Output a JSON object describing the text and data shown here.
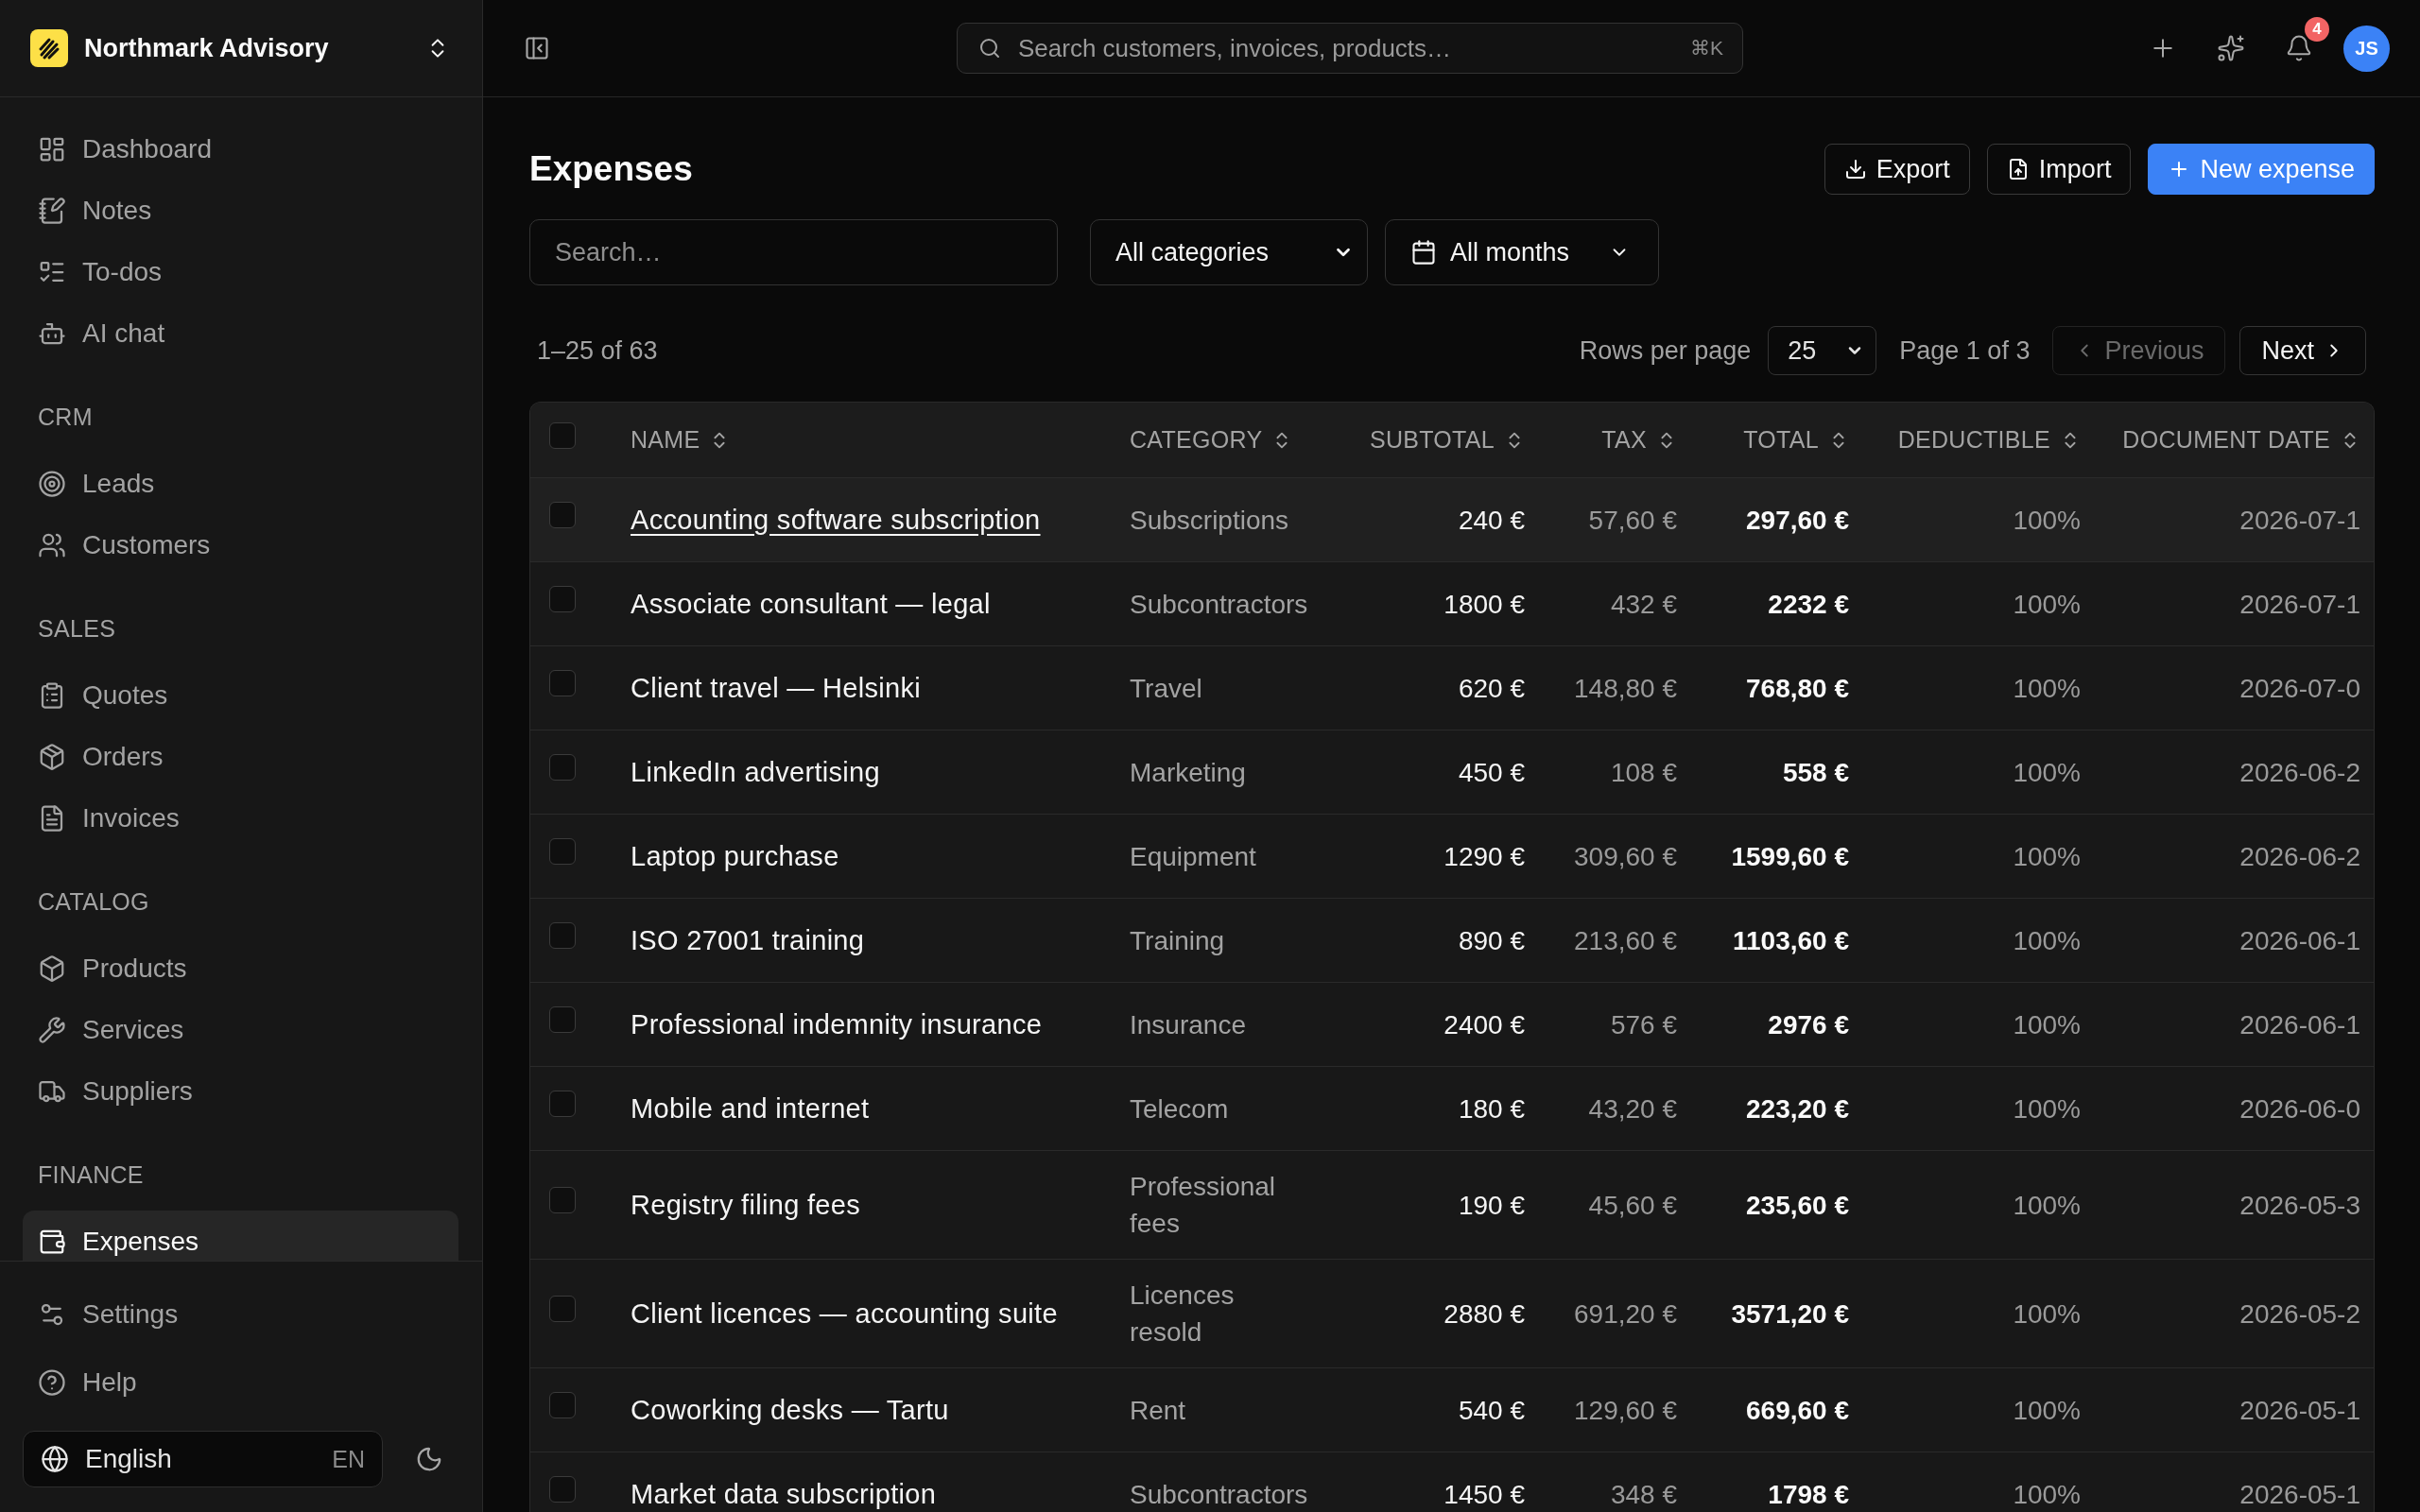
{
  "sidebar": {
    "workspace": "Northmark Advisory",
    "sections": [
      {
        "items": [
          {
            "label": "Dashboard",
            "selected": false
          },
          {
            "label": "Notes",
            "selected": false
          },
          {
            "label": "To-dos",
            "selected": false
          },
          {
            "label": "AI chat",
            "selected": false
          }
        ]
      },
      {
        "title": "CRM",
        "items": [
          {
            "label": "Leads",
            "selected": false
          },
          {
            "label": "Customers",
            "selected": false
          }
        ]
      },
      {
        "title": "SALES",
        "items": [
          {
            "label": "Quotes",
            "selected": false
          },
          {
            "label": "Orders",
            "selected": false
          },
          {
            "label": "Invoices",
            "selected": false
          }
        ]
      },
      {
        "title": "CATALOG",
        "items": [
          {
            "label": "Products",
            "selected": false
          },
          {
            "label": "Services",
            "selected": false
          },
          {
            "label": "Suppliers",
            "selected": false
          }
        ]
      },
      {
        "title": "FINANCE",
        "items": [
          {
            "label": "Expenses",
            "selected": true
          }
        ]
      }
    ],
    "footer_items": [
      {
        "label": "Settings",
        "selected": false
      },
      {
        "label": "Help",
        "selected": false
      }
    ],
    "language": {
      "label": "English",
      "code": "EN"
    }
  },
  "top_bar": {
    "search": {
      "placeholder": "Search customers, invoices, products…",
      "shortcut": "⌘K"
    },
    "notification_count": "4",
    "avatar_initials": "JS"
  },
  "page": {
    "title": "Expenses",
    "actions": [
      {
        "label": "Export",
        "kind": "secondary"
      },
      {
        "label": "Import",
        "kind": "secondary"
      },
      {
        "label": "New expense",
        "kind": "primary"
      }
    ],
    "filters": {
      "search": {
        "placeholder": "Search…"
      },
      "category": {
        "value": "All categories"
      },
      "month": {
        "value": "All months"
      }
    },
    "pagination": {
      "summary": "1–25 of 63",
      "rows_per_page_label": "Rows per page",
      "rows_per_page": "25",
      "page_label": "Page 1 of 3",
      "previous": {
        "label": "Previous",
        "disabled": true
      },
      "next": {
        "label": "Next",
        "disabled": false
      }
    }
  },
  "table": {
    "all_checked": false,
    "columns": [
      "NAME",
      "CATEGORY",
      "SUBTOTAL",
      "TAX",
      "TOTAL",
      "DEDUCTIBLE",
      "DOCUMENT DATE"
    ],
    "rows": [
      {
        "checked": false,
        "hovered": true,
        "name": "Accounting software subscription",
        "category": "Subscriptions",
        "subtotal": "240 €",
        "tax": "57,60 €",
        "total": "297,60 €",
        "deductible": "100%",
        "document_date": "2026-07-1"
      },
      {
        "checked": false,
        "hovered": false,
        "name": "Associate consultant — legal",
        "category": "Subcontractors",
        "subtotal": "1800 €",
        "tax": "432 €",
        "total": "2232 €",
        "deductible": "100%",
        "document_date": "2026-07-1"
      },
      {
        "checked": false,
        "hovered": false,
        "name": "Client travel — Helsinki",
        "category": "Travel",
        "subtotal": "620 €",
        "tax": "148,80 €",
        "total": "768,80 €",
        "deductible": "100%",
        "document_date": "2026-07-0"
      },
      {
        "checked": false,
        "hovered": false,
        "name": "LinkedIn advertising",
        "category": "Marketing",
        "subtotal": "450 €",
        "tax": "108 €",
        "total": "558 €",
        "deductible": "100%",
        "document_date": "2026-06-2"
      },
      {
        "checked": false,
        "hovered": false,
        "name": "Laptop purchase",
        "category": "Equipment",
        "subtotal": "1290 €",
        "tax": "309,60 €",
        "total": "1599,60 €",
        "deductible": "100%",
        "document_date": "2026-06-2"
      },
      {
        "checked": false,
        "hovered": false,
        "name": "ISO 27001 training",
        "category": "Training",
        "subtotal": "890 €",
        "tax": "213,60 €",
        "total": "1103,60 €",
        "deductible": "100%",
        "document_date": "2026-06-1"
      },
      {
        "checked": false,
        "hovered": false,
        "name": "Professional indemnity insurance",
        "category": "Insurance",
        "subtotal": "2400 €",
        "tax": "576 €",
        "total": "2976 €",
        "deductible": "100%",
        "document_date": "2026-06-1"
      },
      {
        "checked": false,
        "hovered": false,
        "name": "Mobile and internet",
        "category": "Telecom",
        "subtotal": "180 €",
        "tax": "43,20 €",
        "total": "223,20 €",
        "deductible": "100%",
        "document_date": "2026-06-0"
      },
      {
        "checked": false,
        "hovered": false,
        "name": "Registry filing fees",
        "category": "Professional fees",
        "subtotal": "190 €",
        "tax": "45,60 €",
        "total": "235,60 €",
        "deductible": "100%",
        "document_date": "2026-05-3"
      },
      {
        "checked": false,
        "hovered": false,
        "name": "Client licences — accounting suite",
        "category": "Licences resold",
        "subtotal": "2880 €",
        "tax": "691,20 €",
        "total": "3571,20 €",
        "deductible": "100%",
        "document_date": "2026-05-2"
      },
      {
        "checked": false,
        "hovered": false,
        "name": "Coworking desks — Tartu",
        "category": "Rent",
        "subtotal": "540 €",
        "tax": "129,60 €",
        "total": "669,60 €",
        "deductible": "100%",
        "document_date": "2026-05-1"
      },
      {
        "checked": false,
        "hovered": false,
        "name": "Market data subscription",
        "category": "Subcontractors",
        "subtotal": "1450 €",
        "tax": "348 €",
        "total": "1798 €",
        "deductible": "100%",
        "document_date": "2026-05-1"
      }
    ]
  }
}
